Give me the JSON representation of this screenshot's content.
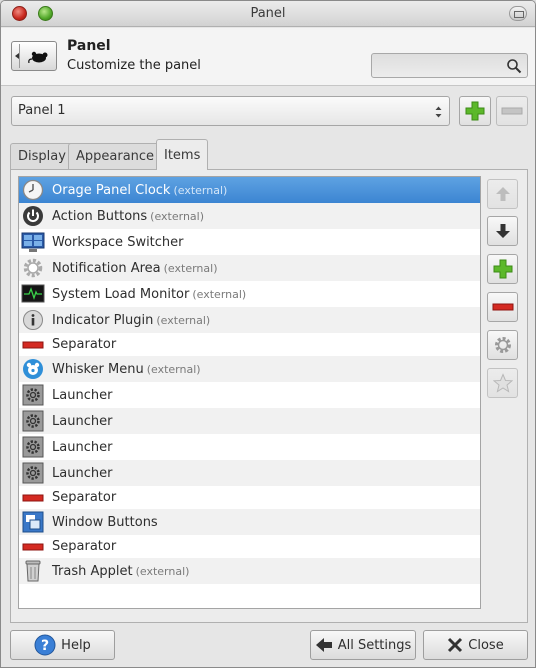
{
  "window": {
    "title": "Panel"
  },
  "header": {
    "title": "Panel",
    "subtitle": "Customize the panel",
    "search_value": ""
  },
  "panel_selector": {
    "selected": "Panel 1"
  },
  "tabs": [
    {
      "label": "Display",
      "active": false
    },
    {
      "label": "Appearance",
      "active": false
    },
    {
      "label": "Items",
      "active": true
    }
  ],
  "items": [
    {
      "name": "Orage Panel Clock",
      "external": "(external)",
      "icon": "clock-icon",
      "selected": true
    },
    {
      "name": "Action Buttons",
      "external": "(external)",
      "icon": "power-icon"
    },
    {
      "name": "Workspace Switcher",
      "external": "",
      "icon": "workspace-icon"
    },
    {
      "name": "Notification Area",
      "external": "(external)",
      "icon": "gear-outline-icon"
    },
    {
      "name": "System Load Monitor",
      "external": "(external)",
      "icon": "monitor-icon"
    },
    {
      "name": "Indicator Plugin",
      "external": "(external)",
      "icon": "info-icon"
    },
    {
      "name": "Separator",
      "external": "",
      "icon": "separator-icon"
    },
    {
      "name": "Whisker Menu",
      "external": "(external)",
      "icon": "whisker-icon"
    },
    {
      "name": "Launcher",
      "external": "",
      "icon": "launcher-icon"
    },
    {
      "name": "Launcher",
      "external": "",
      "icon": "launcher-icon"
    },
    {
      "name": "Launcher",
      "external": "",
      "icon": "launcher-icon"
    },
    {
      "name": "Launcher",
      "external": "",
      "icon": "launcher-icon"
    },
    {
      "name": "Separator",
      "external": "",
      "icon": "separator-icon"
    },
    {
      "name": "Window Buttons",
      "external": "",
      "icon": "windows-icon"
    },
    {
      "name": "Separator",
      "external": "",
      "icon": "separator-icon"
    },
    {
      "name": "Trash Applet",
      "external": "(external)",
      "icon": "trash-icon"
    }
  ],
  "buttons": {
    "help": "Help",
    "all_settings": "All Settings",
    "close": "Close"
  },
  "colors": {
    "selection": "#4a90d9",
    "add": "#5cb82a",
    "remove": "#d42a22"
  }
}
